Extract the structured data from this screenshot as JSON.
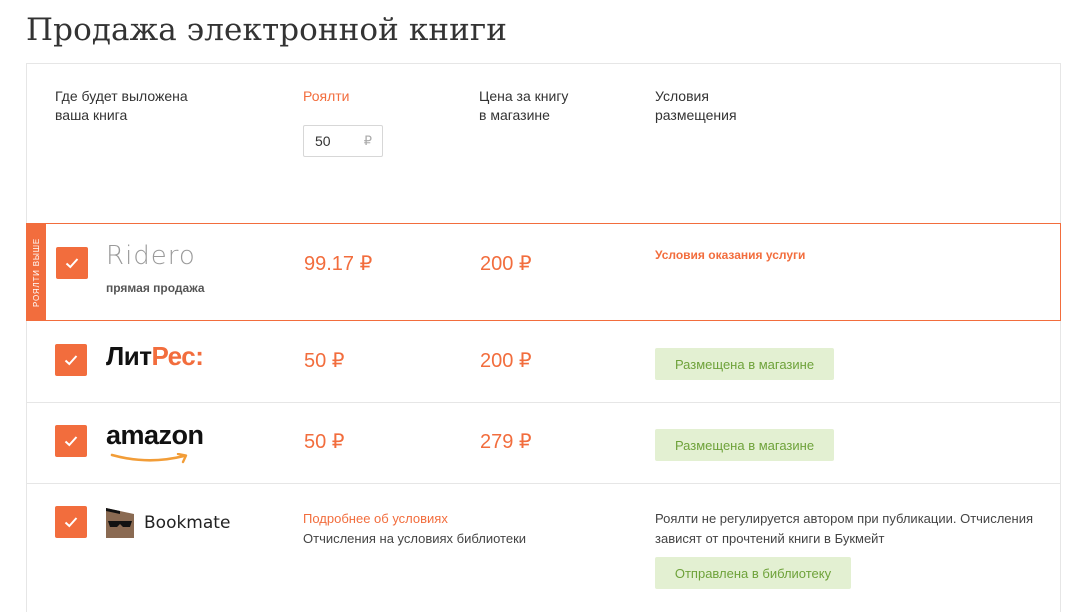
{
  "page": {
    "title": "Продажа электронной книги"
  },
  "table_header": {
    "where": "Где будет выложена\nваша книга",
    "royalty": "Роялти",
    "royalty_value": "50",
    "royalty_currency": "₽",
    "price": "Цена за книгу\nв магазине",
    "terms": "Условия\nразмещения"
  },
  "rows": [
    {
      "store": "ridero",
      "logo_text": "Ridero",
      "subtitle": "прямая продажа",
      "side_tag": "Роялти выше",
      "checked": true,
      "royalty": "99.17 ₽",
      "price": "200 ₽",
      "terms_link": "Условия оказания услуги"
    },
    {
      "store": "litres",
      "logo_text_a": "Лит",
      "logo_text_b": "Рес",
      "logo_text_c": ":",
      "checked": true,
      "royalty": "50 ₽",
      "price": "200 ₽",
      "status": "Размещена в магазине"
    },
    {
      "store": "amazon",
      "logo_text": "amazon",
      "checked": true,
      "royalty": "50 ₽",
      "price": "279 ₽",
      "status": "Размещена в магазине"
    },
    {
      "store": "bookmate",
      "logo_text": "Bookmate",
      "checked": true,
      "more_link": "Подробнее об условиях",
      "more_text": "Отчисления на условиях библиотеки",
      "note": "Роялти не регулируется автором при публикации. Отчисления зависят от прочтений книги в Букмейт",
      "status": "Отправлена в библиотеку"
    }
  ],
  "colors": {
    "accent": "#f26d3d",
    "status_bg": "#e3f0d2",
    "status_text": "#6ea23a"
  },
  "icons": {
    "checkbox": "check-icon",
    "bookmate_logo": "bookmate-mask-icon",
    "amazon_smile": "amazon-smile-icon"
  }
}
